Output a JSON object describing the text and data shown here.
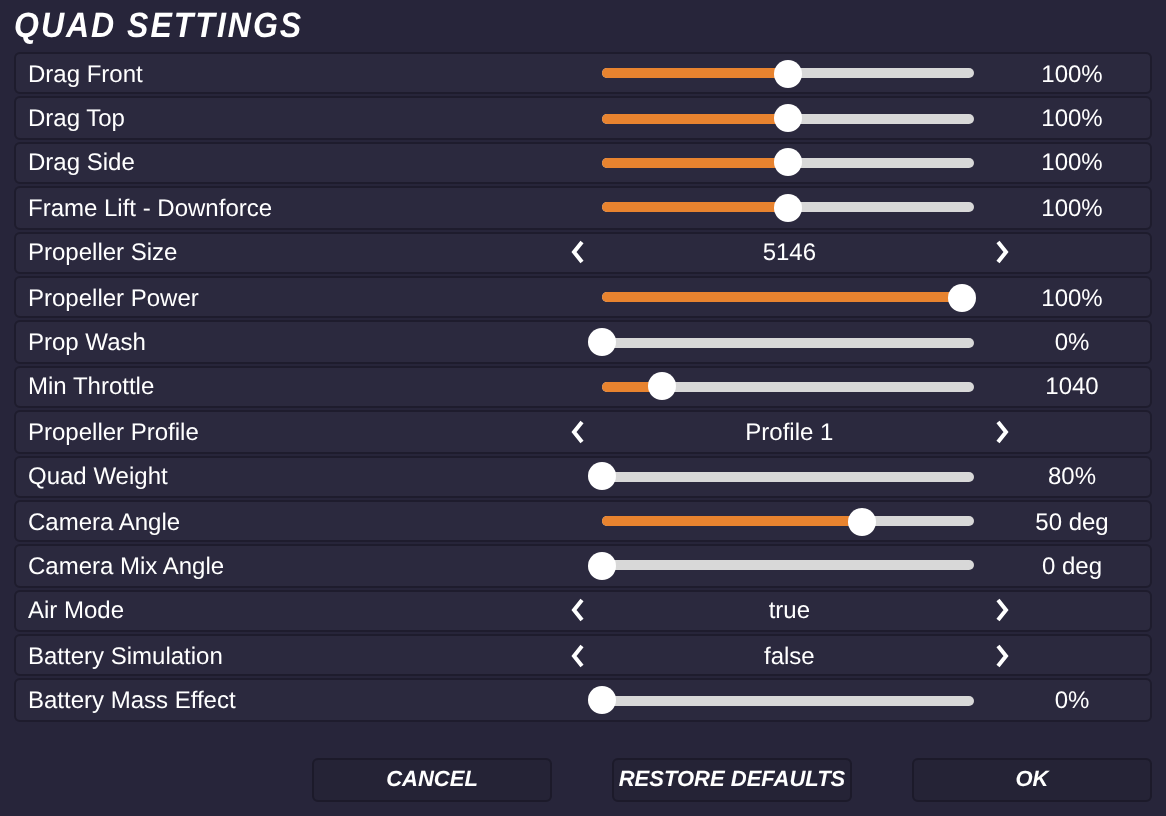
{
  "window": {
    "title": "QUAD SETTINGS"
  },
  "settings": [
    {
      "label": "Drag Front",
      "kind": "slider",
      "level": 0.5,
      "value": "100%"
    },
    {
      "label": "Drag Top",
      "kind": "slider",
      "level": 0.5,
      "value": "100%"
    },
    {
      "label": "Drag Side",
      "kind": "slider",
      "level": 0.5,
      "value": "100%"
    },
    {
      "label": "Frame Lift - Downforce",
      "kind": "slider",
      "level": 0.5,
      "value": "100%"
    },
    {
      "label": "Propeller Size",
      "kind": "stepper",
      "value": "5146"
    },
    {
      "label": "Propeller Power",
      "kind": "slider",
      "level": 0.97,
      "value": "100%"
    },
    {
      "label": "Prop Wash",
      "kind": "slider",
      "level": 0,
      "value": "0%"
    },
    {
      "label": "Min Throttle",
      "kind": "slider",
      "level": 0.16,
      "value": "1040"
    },
    {
      "label": "Propeller Profile",
      "kind": "stepper",
      "value": "Profile 1"
    },
    {
      "label": "Quad Weight",
      "kind": "slider",
      "level": 0,
      "value": "80%"
    },
    {
      "label": "Camera Angle",
      "kind": "slider",
      "level": 0.7,
      "value": "50 deg"
    },
    {
      "label": "Camera Mix Angle",
      "kind": "slider",
      "level": 0,
      "value": "0 deg"
    },
    {
      "label": "Air Mode",
      "kind": "stepper",
      "value": "true"
    },
    {
      "label": "Battery Simulation",
      "kind": "stepper",
      "value": "false"
    },
    {
      "label": "Battery Mass Effect",
      "kind": "slider",
      "level": 0,
      "value": "0%"
    }
  ],
  "buttons": [
    "CANCEL",
    "RESTORE DEFAULTS",
    "OK"
  ]
}
